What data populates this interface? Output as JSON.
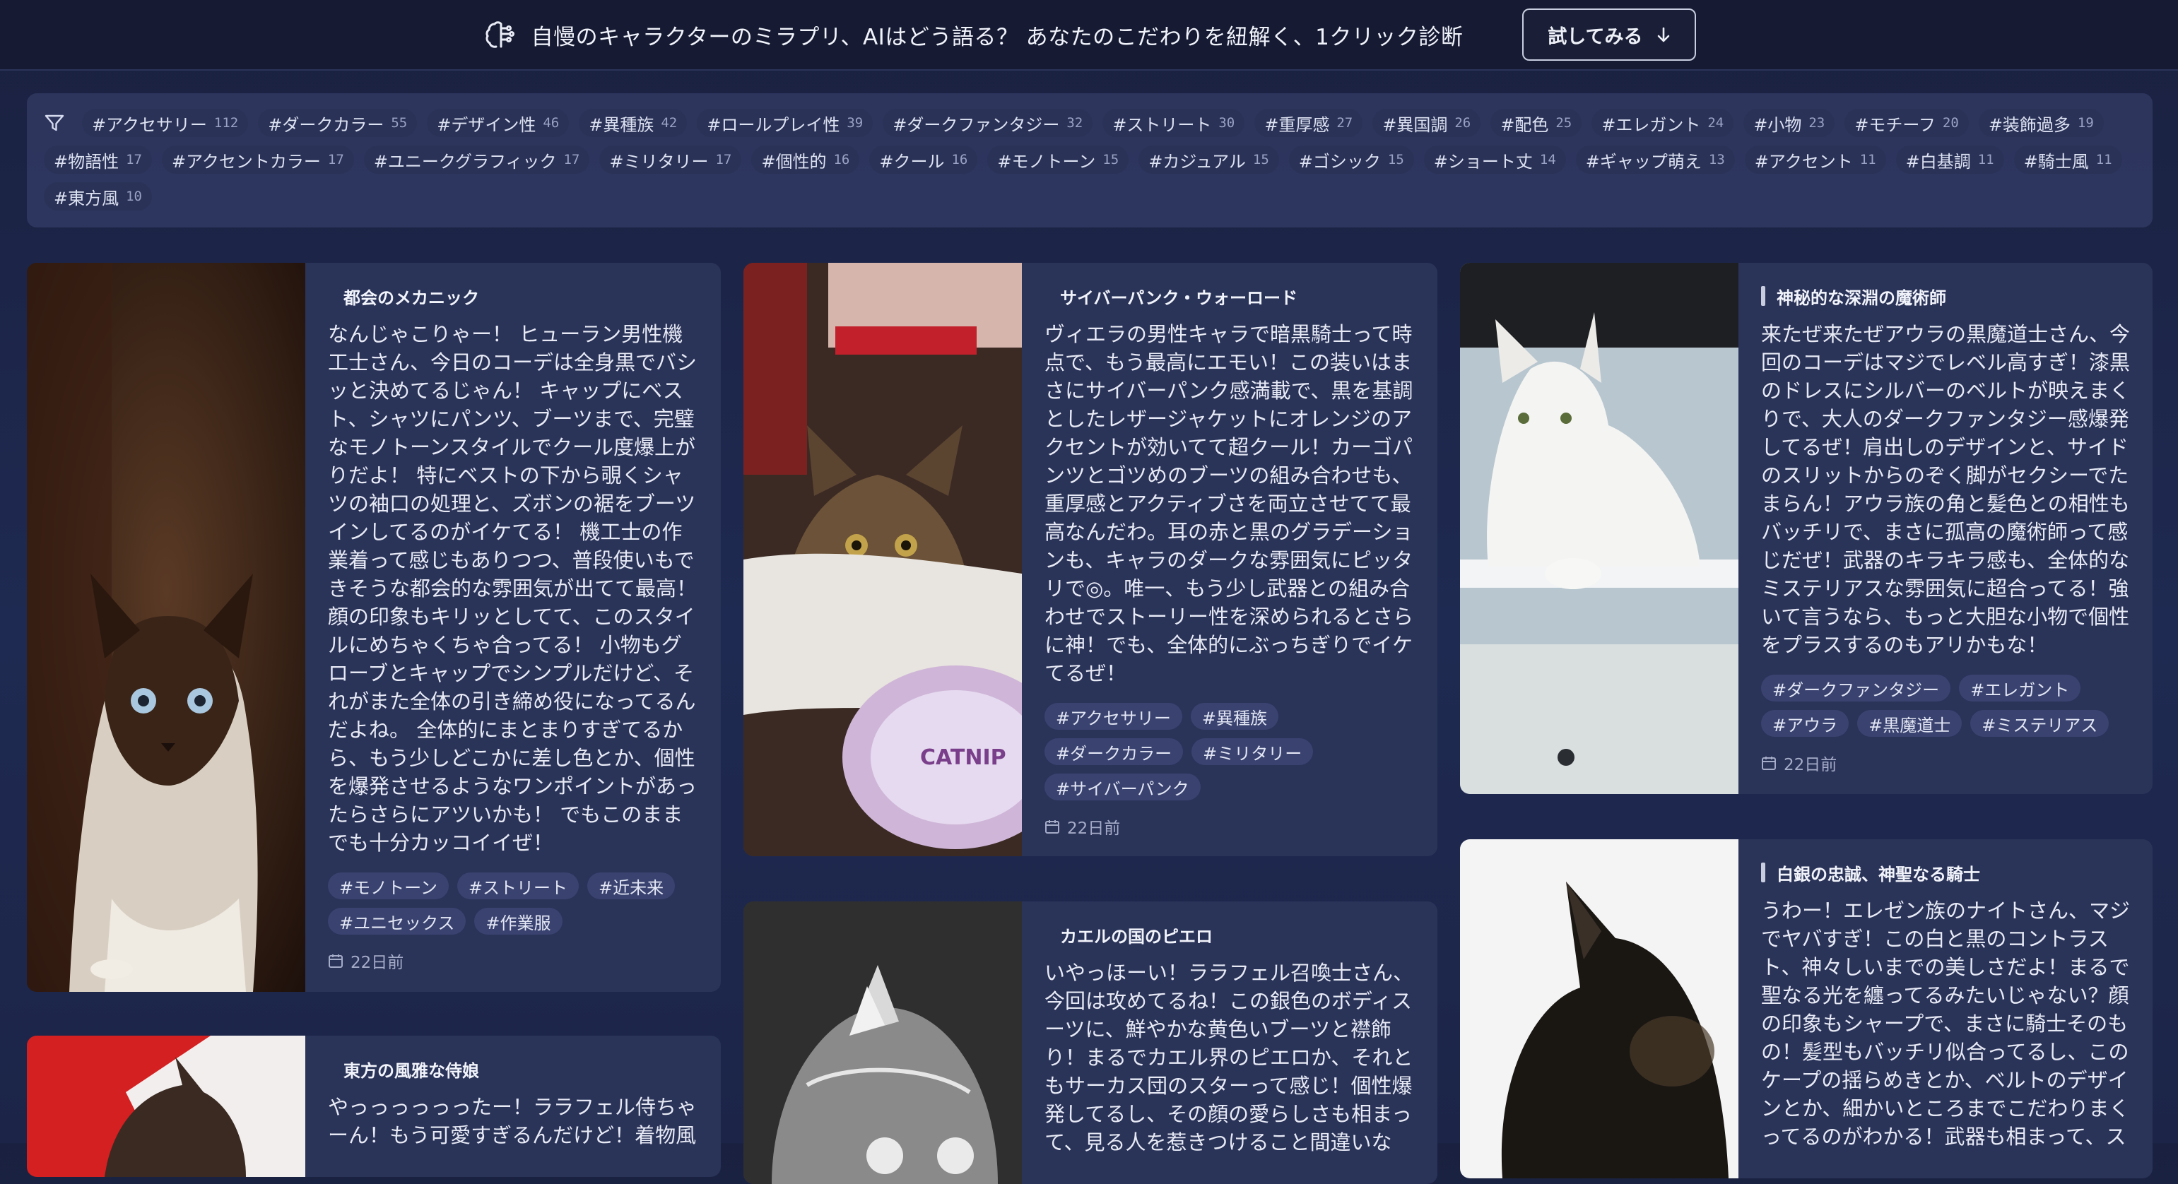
{
  "banner": {
    "text": "自慢のキャラクターのミラプリ、AIはどう語る？ あなたのこだわりを紐解く、1クリック診断",
    "button_label": "試してみる"
  },
  "filter_tags": [
    {
      "label": "#アクセサリー",
      "count": "112"
    },
    {
      "label": "#ダークカラー",
      "count": "55"
    },
    {
      "label": "#デザイン性",
      "count": "46"
    },
    {
      "label": "#異種族",
      "count": "42"
    },
    {
      "label": "#ロールプレイ性",
      "count": "39"
    },
    {
      "label": "#ダークファンタジー",
      "count": "32"
    },
    {
      "label": "#ストリート",
      "count": "30"
    },
    {
      "label": "#重厚感",
      "count": "27"
    },
    {
      "label": "#異国調",
      "count": "26"
    },
    {
      "label": "#配色",
      "count": "25"
    },
    {
      "label": "#エレガント",
      "count": "24"
    },
    {
      "label": "#小物",
      "count": "23"
    },
    {
      "label": "#モチーフ",
      "count": "20"
    },
    {
      "label": "#装飾過多",
      "count": "19"
    },
    {
      "label": "#物語性",
      "count": "17"
    },
    {
      "label": "#アクセントカラー",
      "count": "17"
    },
    {
      "label": "#ユニークグラフィック",
      "count": "17"
    },
    {
      "label": "#ミリタリー",
      "count": "17"
    },
    {
      "label": "#個性的",
      "count": "16"
    },
    {
      "label": "#クール",
      "count": "16"
    },
    {
      "label": "#モノトーン",
      "count": "15"
    },
    {
      "label": "#カジュアル",
      "count": "15"
    },
    {
      "label": "#ゴシック",
      "count": "15"
    },
    {
      "label": "#ショート丈",
      "count": "14"
    },
    {
      "label": "#ギャップ萌え",
      "count": "13"
    },
    {
      "label": "#アクセント",
      "count": "11"
    },
    {
      "label": "#白基調",
      "count": "11"
    },
    {
      "label": "#騎士風",
      "count": "11"
    },
    {
      "label": "#東方風",
      "count": "10"
    }
  ],
  "cards": [
    {
      "title": "都会のメカニック",
      "text": "なんじゃこりゃー！ ヒューラン男性機工士さん、今日のコーデは全身黒でバシッと決めてるじゃん！ キャップにベスト、シャツにパンツ、ブーツまで、完璧なモノトーンスタイルでクール度爆上がりだよ！ 特にベストの下から覗くシャツの袖口の処理と、ズボンの裾をブーツインしてるのがイケてる！ 機工士の作業着って感じもありつつ、普段使いもできそうな都会的な雰囲気が出てて最高！ 顔の印象もキリッとしてて、このスタイルにめちゃくちゃ合ってる！ 小物もグローブとキャップでシンプルだけど、それがまた全体の引き締め役になってるんだよね。 全体的にまとまりすぎてるから、もう少しどこかに差し色とか、個性を爆発させるようなワンポイントがあったらさらにアツいかも！ でもこのままでも十分カッコイイぜ！",
      "tags": [
        "#モノトーン",
        "#ストリート",
        "#近未来",
        "#ユニセックス",
        "#作業服"
      ],
      "date": "22日前"
    },
    {
      "title": "サイバーパンク・ウォーロード",
      "text": "ヴィエラの男性キャラで暗黒騎士って時点で、もう最高にエモい！この装いはまさにサイバーパンク感満載で、黒を基調としたレザージャケットにオレンジのアクセントが効いてて超クール！カーゴパンツとゴツめのブーツの組み合わせも、重厚感とアクティブさを両立させてて最高なんだわ。耳の赤と黒のグラデーションも、キャラのダークな雰囲気にピッタリで◎。唯一、もう少し武器との組み合わせでストーリー性を深められるとさらに神！でも、全体的にぶっちぎりでイケてるぜ！",
      "tags": [
        "#アクセサリー",
        "#異種族",
        "#ダークカラー",
        "#ミリタリー",
        "#サイバーパンク"
      ],
      "date": "22日前"
    },
    {
      "title": "神秘的な深淵の魔術師",
      "text": "来たぜ来たぜアウラの黒魔道士さん、今回のコーデはマジでレベル高すぎ！漆黒のドレスにシルバーのベルトが映えまくりで、大人のダークファンタジー感爆発してるぜ！肩出しのデザインと、サイドのスリットからのぞく脚がセクシーでたまらん！アウラ族の角と髪色との相性もバッチリで、まさに孤高の魔術師って感じだぜ！武器のキラキラ感も、全体的なミステリアスな雰囲気に超合ってる！強いて言うなら、もっと大胆な小物で個性をプラスするのもアリかもな！",
      "tags": [
        "#ダークファンタジー",
        "#エレガント",
        "#アウラ",
        "#黒魔道士",
        "#ミステリアス"
      ],
      "date": "22日前"
    },
    {
      "title": "カエルの国のピエロ",
      "text": "いやっほーい！ララフェル召喚士さん、今回は攻めてるね！この銀色のボディスーツに、鮮やかな黄色いブーツと襟飾り！まるでカエル界のピエロか、それともサーカス団のスターって感じ！個性爆発してるし、その顔の愛らしさも相まって、見る人を惹きつけること間違いな",
      "tags": [],
      "date": ""
    },
    {
      "title": "白銀の忠誠、神聖なる騎士",
      "text": "うわー！エレゼン族のナイトさん、マジでヤバすぎ！この白と黒のコントラスト、神々しいまでの美しさだよ！まるで聖なる光を纏ってるみたいじゃない？顔の印象もシャープで、まさに騎士そのもの！髪型もバッチリ似合ってるし、このケープの揺らめきとか、ベルトのデザインとか、細かいところまでこだわりまくってるのがわかる！武器も相まって、ス",
      "tags": [],
      "date": ""
    },
    {
      "title": "東方の風雅な侍娘",
      "text": "やっっっっっったー！ララフェル侍ちゃーん！もう可愛すぎるんだけど！着物風",
      "tags": [],
      "date": ""
    }
  ],
  "colors": {
    "background": "#1f2a52",
    "banner_bg": "#161b33",
    "card_bg": "#2a3358",
    "tag_bg": "#3a4370"
  }
}
